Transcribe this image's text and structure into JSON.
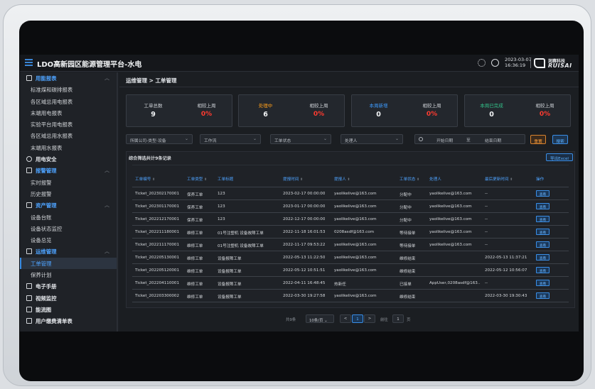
{
  "header": {
    "title": "LDO高新园区能源管理平台-水电",
    "date": "2023-03-07",
    "time": "16:36:19",
    "logo_cn": "润赛科技",
    "logo_en": "RUISAI"
  },
  "sidebar": {
    "items": [
      {
        "type": "group",
        "label": "用能报表",
        "icon": "report-icon",
        "open": true
      },
      {
        "type": "sub",
        "label": "标准煤和碳排报表"
      },
      {
        "type": "sub",
        "label": "各区域总用电报表"
      },
      {
        "type": "sub",
        "label": "末端用电报表"
      },
      {
        "type": "sub",
        "label": "实验平台用电报表"
      },
      {
        "type": "sub",
        "label": "各区域总用水报表"
      },
      {
        "type": "sub",
        "label": "末端用水报表"
      },
      {
        "type": "group",
        "label": "用电安全",
        "icon": "safety-icon"
      },
      {
        "type": "group",
        "label": "报警管理",
        "icon": "alarm-icon",
        "open": true
      },
      {
        "type": "sub",
        "label": "实时报警"
      },
      {
        "type": "sub",
        "label": "历史报警"
      },
      {
        "type": "group",
        "label": "资产管理",
        "icon": "asset-icon",
        "open": true
      },
      {
        "type": "sub",
        "label": "设备台账"
      },
      {
        "type": "sub",
        "label": "设备状态监控"
      },
      {
        "type": "sub",
        "label": "设备总览"
      },
      {
        "type": "group",
        "label": "运维管理",
        "icon": "maintenance-icon",
        "open": true
      },
      {
        "type": "sub",
        "label": "工单管理",
        "active": true
      },
      {
        "type": "sub",
        "label": "保养计划"
      },
      {
        "type": "group",
        "label": "电子手册",
        "icon": "manual-icon"
      },
      {
        "type": "group",
        "label": "视频监控",
        "icon": "video-icon"
      },
      {
        "type": "group",
        "label": "能流图",
        "icon": "flow-icon"
      },
      {
        "type": "group",
        "label": "用户缴费清单表",
        "icon": "bill-icon"
      }
    ]
  },
  "breadcrumb": "运维管理 > 工单管理",
  "stats": [
    {
      "label": "工单总数",
      "value": "9",
      "compare_label": "相较上周",
      "compare_value": "0%",
      "color": "default"
    },
    {
      "label": "处理中",
      "value": "6",
      "compare_label": "相较上周",
      "compare_value": "0%",
      "color": "orange"
    },
    {
      "label": "本周新增",
      "value": "0",
      "compare_label": "相较上周",
      "compare_value": "0%",
      "color": "blue"
    },
    {
      "label": "本周已完成",
      "value": "0",
      "compare_label": "相较上周",
      "compare_value": "0%",
      "color": "green"
    }
  ],
  "filters": {
    "company_type": "所属公司-类型-设备",
    "workflow": "工作流",
    "status": "工单状态",
    "handler": "处理人",
    "start_date": "开始日期",
    "date_sep": "至",
    "end_date": "结束日期",
    "reset": "重置",
    "search": "搜索"
  },
  "panel": {
    "title": "综合筛选共计9条记录",
    "export": "导出Excel"
  },
  "table": {
    "headers": [
      "工单编号",
      "工单类型",
      "工单标题",
      "提报时间",
      "提报人",
      "工单状态",
      "处理人",
      "最后更新时间",
      "操作"
    ],
    "view_label": "查看",
    "rows": [
      [
        "Ticket_202302170001",
        "保养工单",
        "123",
        "2023-02-17 00:00:00",
        "yaolikelive@163.com",
        "分配中",
        "yaolikelive@163.com",
        "--"
      ],
      [
        "Ticket_202301170001",
        "保养工单",
        "123",
        "2023-01-17 00:00:00",
        "yaolikelive@163.com",
        "分配中",
        "yaolikelive@163.com",
        "--"
      ],
      [
        "Ticket_202212170001",
        "保养工单",
        "123",
        "2022-12-17 00:00:00",
        "yaolikelive@163.com",
        "分配中",
        "yaolikelive@163.com",
        "--"
      ],
      [
        "Ticket_202211180001",
        "维修工单",
        "01号注塑机 设备故障工单",
        "2022-11-18 16:01:53",
        "0208asdf@163.com",
        "等待接单",
        "yaolikelive@163.com",
        "--"
      ],
      [
        "Ticket_202211170001",
        "维修工单",
        "01号注塑机 设备故障工单",
        "2022-11-17 09:53:22",
        "yaolikelive@163.com",
        "等待接单",
        "yaolikelive@163.com",
        "--"
      ],
      [
        "Ticket_202205130001",
        "维修工单",
        "设备报障工单",
        "2022-05-13 11:22:50",
        "yaolikelive@163.com",
        "维修结束",
        "",
        "2022-05-13 11:37:21"
      ],
      [
        "Ticket_202205120001",
        "维修工单",
        "设备报障工单",
        "2022-05-12 10:51:51",
        "yaolikelive@163.com",
        "维修结束",
        "",
        "2022-05-12 10:56:07"
      ],
      [
        "Ticket_202204110001",
        "维修工单",
        "设备报障工单",
        "2022-04-11 16:48:45",
        "热新任",
        "已接单",
        "AppUser,0208asdf@163...",
        "--"
      ],
      [
        "Ticket_202203300002",
        "维修工单",
        "设备报障工单",
        "2022-03-30 19:27:58",
        "yaolikelive@163.com",
        "维修结束",
        "",
        "2022-03-30 19:30:43"
      ]
    ]
  },
  "pager": {
    "total": "共9条",
    "page_size": "10条/页",
    "prev": "<",
    "current": "1",
    "next": ">",
    "goto_prefix": "前往",
    "goto_value": "1",
    "goto_suffix": "页"
  }
}
